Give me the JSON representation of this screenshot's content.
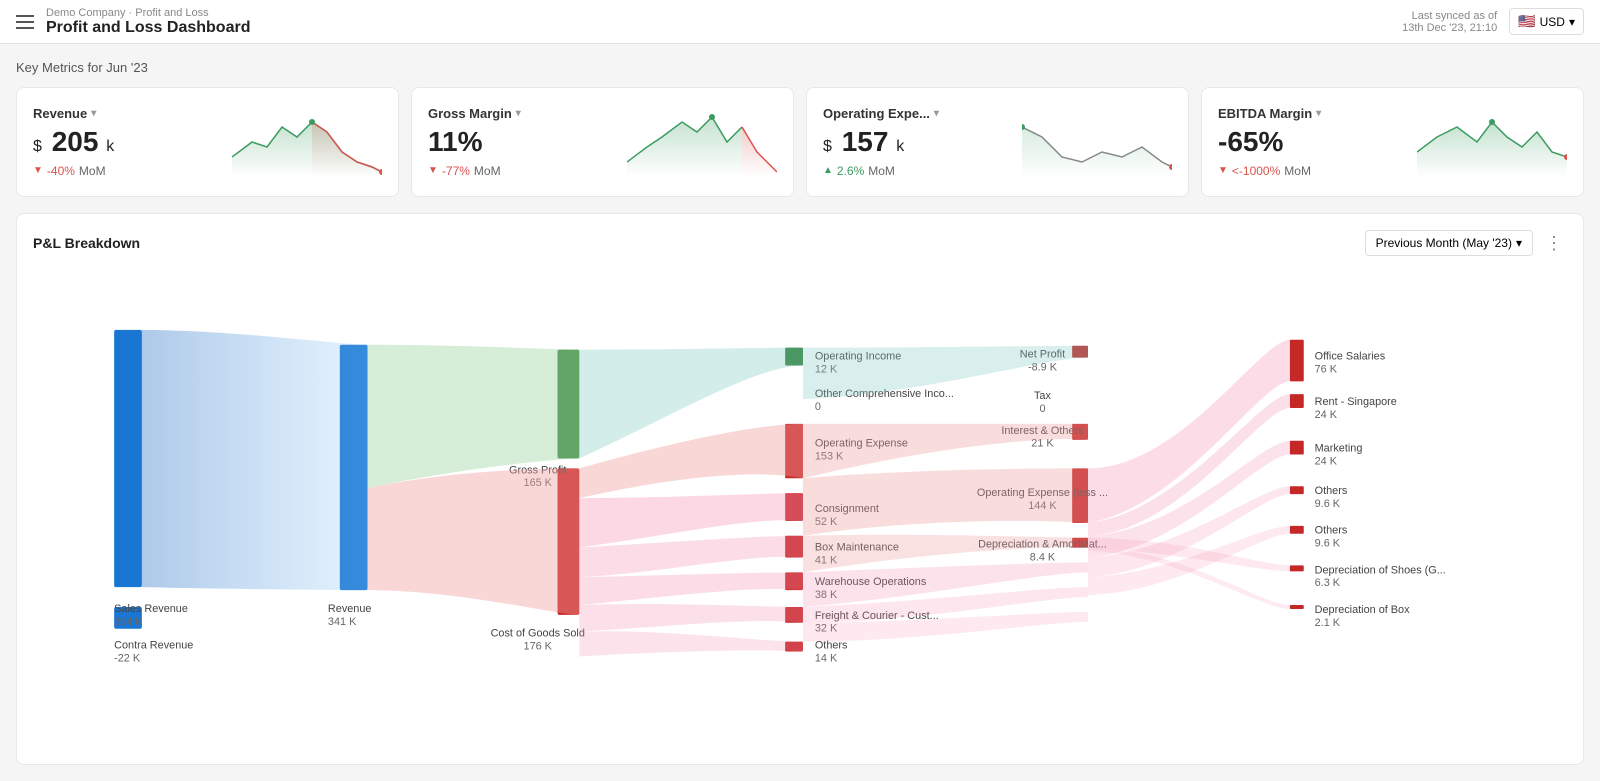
{
  "topbar": {
    "breadcrumb": "Demo Company · Profit and Loss",
    "title": "Profit and Loss Dashboard",
    "sync_label": "Last synced as of",
    "sync_time": "13th Dec '23, 21:10",
    "currency": "USD",
    "currency_flag": "🇺🇸"
  },
  "metrics_section": {
    "section_title": "Key Metrics for Jun '23",
    "cards": [
      {
        "id": "revenue",
        "label": "Revenue",
        "has_dollar": true,
        "value": "205",
        "unit": "k",
        "mom_value": "-40%",
        "mom_label": "MoM",
        "mom_direction": "down"
      },
      {
        "id": "gross-margin",
        "label": "Gross Margin",
        "has_dollar": false,
        "value": "11%",
        "unit": "",
        "mom_value": "-77%",
        "mom_label": "MoM",
        "mom_direction": "down"
      },
      {
        "id": "operating-expense",
        "label": "Operating Expe...",
        "has_dollar": true,
        "value": "157",
        "unit": "k",
        "mom_value": "2.6%",
        "mom_label": "MoM",
        "mom_direction": "up"
      },
      {
        "id": "ebitda-margin",
        "label": "EBITDA Margin",
        "has_dollar": false,
        "value": "-65%",
        "unit": "",
        "mom_value": "<-1000%",
        "mom_label": "MoM",
        "mom_direction": "down"
      }
    ]
  },
  "breakdown": {
    "title": "P&L Breakdown",
    "period_label": "Previous Month (May '23)",
    "nodes": {
      "left": [
        {
          "label": "Sales Revenue",
          "value": "364 K"
        },
        {
          "label": "Contra Revenue",
          "value": "-22 K"
        }
      ],
      "mid_left": [
        {
          "label": "Revenue",
          "value": "341 K"
        }
      ],
      "mid": [
        {
          "label": "Gross Profit",
          "value": "165 K"
        },
        {
          "label": "Cost of Goods Sold",
          "value": "176 K"
        }
      ],
      "right1": [
        {
          "label": "Operating Income",
          "value": "12 K"
        },
        {
          "label": "Other Comprehensive Inco...",
          "value": "0"
        },
        {
          "label": "Operating Expense",
          "value": "153 K"
        },
        {
          "label": "Consignment",
          "value": "52 K"
        },
        {
          "label": "Box Maintenance",
          "value": "41 K"
        },
        {
          "label": "Warehouse Operations",
          "value": "38 K"
        },
        {
          "label": "Freight & Courier - Cust...",
          "value": "32 K"
        },
        {
          "label": "Others",
          "value": "14 K"
        }
      ],
      "right2": [
        {
          "label": "Net Profit",
          "value": "-8.9 K"
        },
        {
          "label": "Tax",
          "value": "0"
        },
        {
          "label": "Interest & Others",
          "value": "21 K"
        },
        {
          "label": "Operating Expense (less ...",
          "value": "144 K"
        },
        {
          "label": "Depreciation & Amortizat...",
          "value": "8.4 K"
        }
      ],
      "right3": [
        {
          "label": "Office Salaries",
          "value": "76 K"
        },
        {
          "label": "Rent - Singapore",
          "value": "24 K"
        },
        {
          "label": "Marketing",
          "value": "24 K"
        },
        {
          "label": "Others",
          "value": "9.6 K"
        },
        {
          "label": "Others",
          "value": "9.6 K"
        },
        {
          "label": "Depreciation of Shoes (G...",
          "value": "6.3 K"
        },
        {
          "label": "Depreciation of Box",
          "value": "2.1 K"
        }
      ]
    }
  }
}
